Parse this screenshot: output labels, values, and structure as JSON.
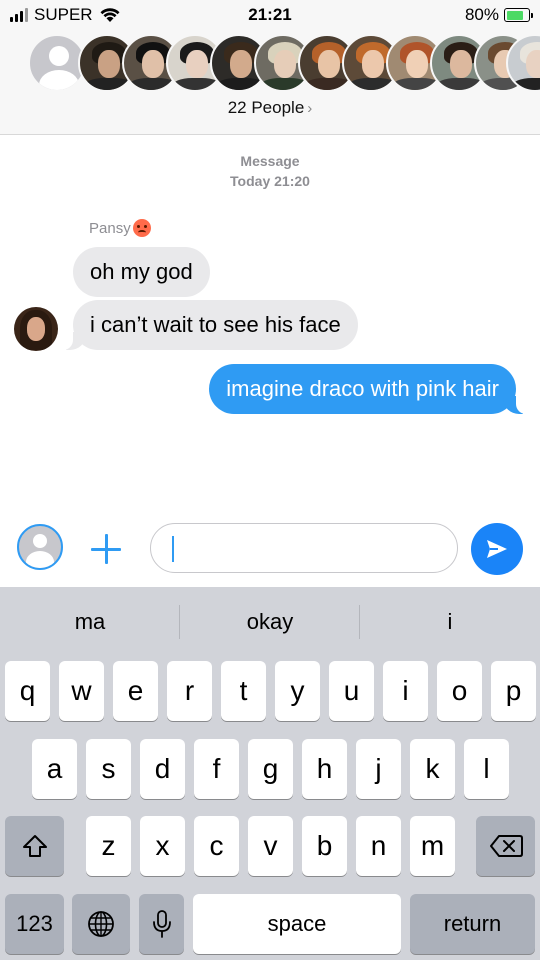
{
  "status_bar": {
    "carrier": "SUPER",
    "time": "21:21",
    "battery_text": "80%",
    "battery_level": 0.8
  },
  "group": {
    "people_count": "22 People",
    "chevron": "›"
  },
  "conversation": {
    "timestamp_label": "Message",
    "timestamp_value": "Today 21:20",
    "sender_name": "Pansy",
    "messages": [
      {
        "text": "oh my god",
        "direction": "incoming"
      },
      {
        "text": "i can’t wait to see his face",
        "direction": "incoming"
      },
      {
        "text": "imagine draco with pink hair",
        "direction": "outgoing"
      }
    ]
  },
  "input_bar": {
    "text_value": ""
  },
  "keyboard": {
    "suggestions": [
      "ma",
      "okay",
      "i"
    ],
    "row1": [
      "q",
      "w",
      "e",
      "r",
      "t",
      "y",
      "u",
      "i",
      "o",
      "p"
    ],
    "row2": [
      "a",
      "s",
      "d",
      "f",
      "g",
      "h",
      "j",
      "k",
      "l"
    ],
    "row3": [
      "z",
      "x",
      "c",
      "v",
      "b",
      "n",
      "m"
    ],
    "numbers_label": "123",
    "space_label": "space",
    "return_label": "return"
  },
  "colors": {
    "accent": "#2f9bf3",
    "incoming_bubble": "#e9e9eb",
    "keyboard_bg": "#d1d3d9"
  }
}
